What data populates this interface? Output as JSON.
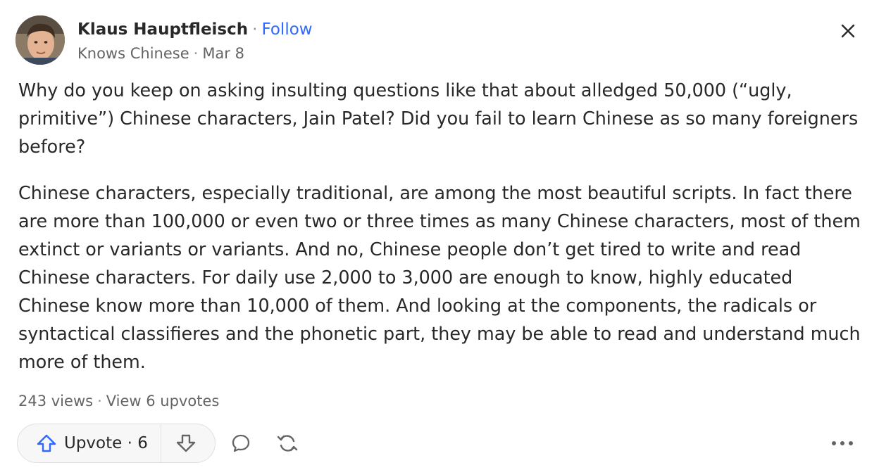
{
  "post": {
    "author_name": "Klaus Hauptfleisch",
    "follow_label": "Follow",
    "credential": "Knows Chinese",
    "date": "Mar 8",
    "separator": "·"
  },
  "content": {
    "paragraphs": [
      "Why do you keep on asking insulting questions like that about alledged 50,000 (“ugly, primitive”) Chinese characters, Jain Patel? Did you fail to learn Chinese as so many foreigners before?",
      "Chinese characters, especially traditional, are among the most beautiful scripts. In fact there are more than 100,000 or even two or three times as many Chinese characters, most of them extinct or variants or variants. And no, Chinese people don’t get tired to write and read Chinese characters. For daily use 2,000 to 3,000 are enough to know, highly educated Chinese know more than 10,000 of them. And looking at the components, the radicals or syntactical classifieres and the phonetic part, they may be able to read and understand much more of them."
    ]
  },
  "stats": {
    "views": "243 views",
    "upvotes_link": "View 6 upvotes"
  },
  "actions": {
    "upvote_label": "Upvote · 6"
  },
  "icons": {
    "close": "close-icon",
    "upvote": "arrow-up-icon",
    "downvote": "arrow-down-icon",
    "comment": "comment-icon",
    "share": "share-icon",
    "more": "more-icon"
  },
  "colors": {
    "text": "#282829",
    "secondary": "#636466",
    "accent": "#2e69ff",
    "upvote_icon": "#2e69ff",
    "pill_bg": "#f7f7f8"
  }
}
